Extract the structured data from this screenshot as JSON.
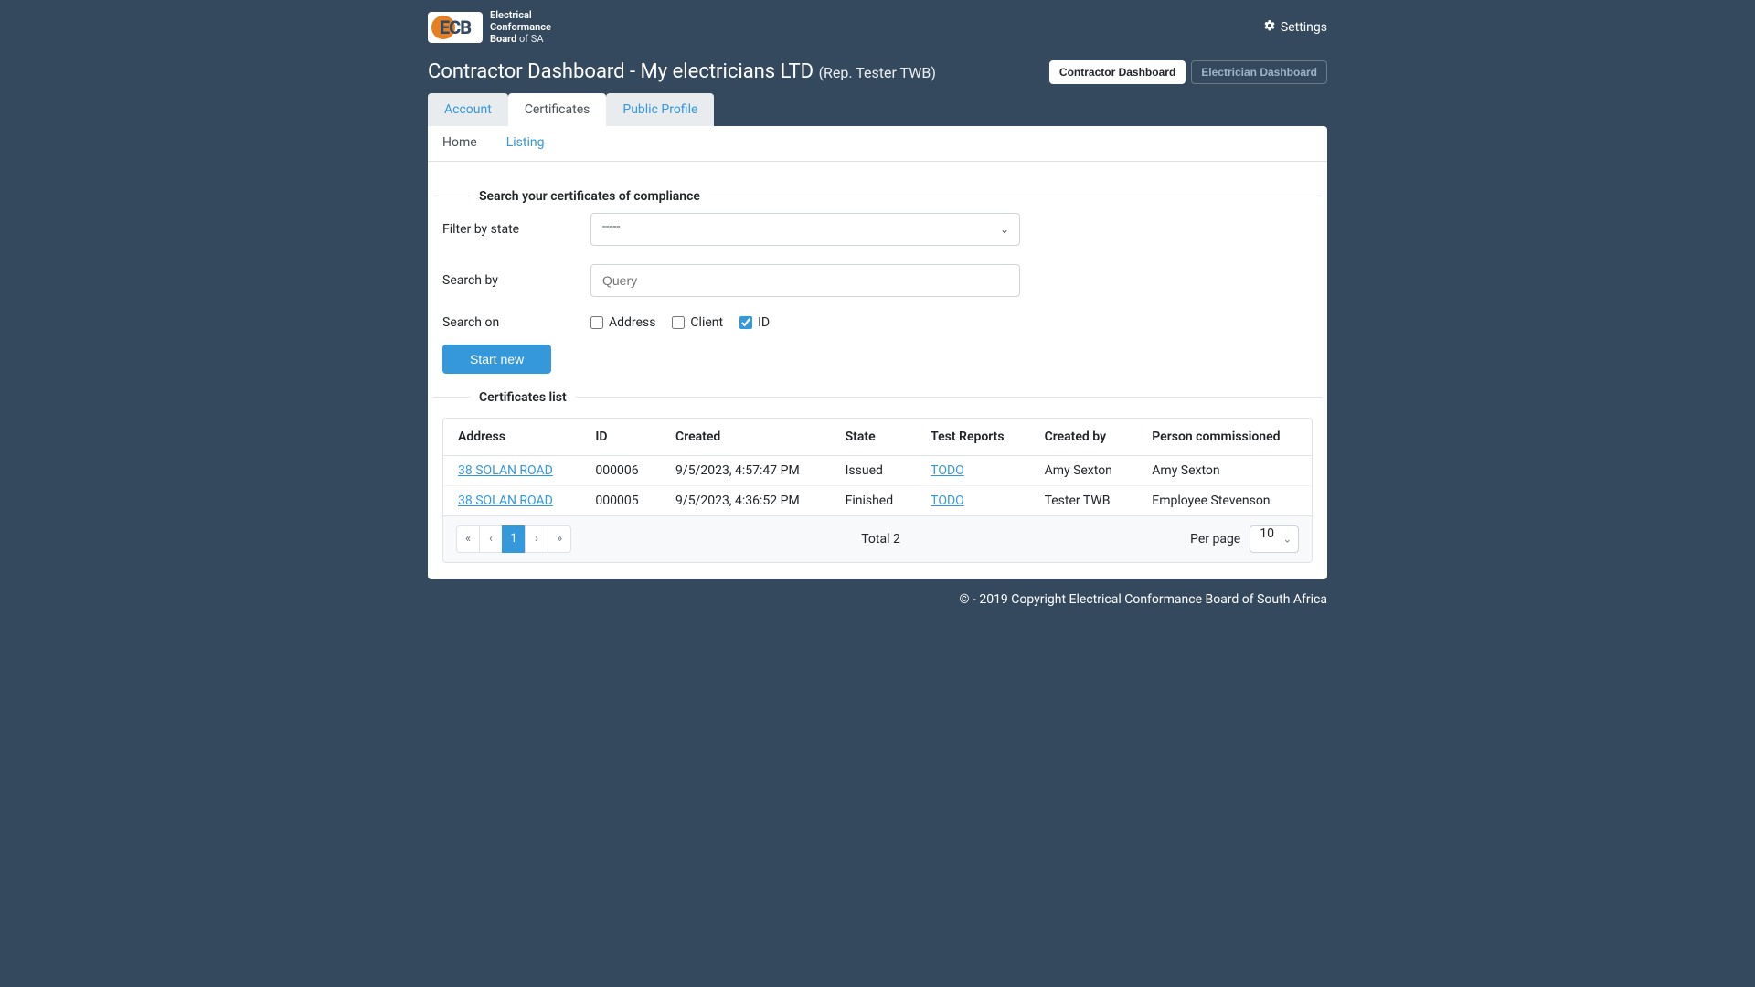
{
  "header": {
    "logo_abbrev": "ECB",
    "logo_line1": "Electrical",
    "logo_line2": "Conformance",
    "logo_line3": "Board",
    "logo_suffix": "of SA",
    "settings_label": "Settings"
  },
  "title": {
    "main": "Contractor Dashboard - My electricians LTD",
    "sub": "(Rep. Tester TWB)"
  },
  "dash_toggle": {
    "contractor": "Contractor Dashboard",
    "electrician": "Electrician Dashboard"
  },
  "main_tabs": {
    "account": "Account",
    "certificates": "Certificates",
    "public_profile": "Public Profile"
  },
  "sub_tabs": {
    "home": "Home",
    "listing": "Listing"
  },
  "search_section": {
    "legend": "Search your certificates of compliance",
    "filter_label": "Filter by state",
    "filter_value": "-----",
    "search_by_label": "Search by",
    "search_by_placeholder": "Query",
    "search_on_label": "Search on",
    "chk_address": "Address",
    "chk_client": "Client",
    "chk_id": "ID",
    "chk_address_checked": false,
    "chk_client_checked": false,
    "chk_id_checked": true,
    "start_new": "Start new"
  },
  "list_section": {
    "legend": "Certificates list",
    "columns": {
      "address": "Address",
      "id": "ID",
      "created": "Created",
      "state": "State",
      "test_reports": "Test Reports",
      "created_by": "Created by",
      "person_commissioned": "Person commissioned"
    },
    "rows": [
      {
        "address": "38 SOLAN ROAD",
        "id": "000006",
        "created": "9/5/2023, 4:57:47 PM",
        "state": "Issued",
        "test_reports": "TODO",
        "created_by": "Amy Sexton",
        "person_commissioned": "Amy Sexton"
      },
      {
        "address": "38 SOLAN ROAD",
        "id": "000005",
        "created": "9/5/2023, 4:36:52 PM",
        "state": "Finished",
        "test_reports": "TODO",
        "created_by": "Tester TWB",
        "person_commissioned": "Employee Stevenson"
      }
    ],
    "pager": {
      "first": "«",
      "prev": "‹",
      "page1": "1",
      "next": "›",
      "last": "»"
    },
    "total_label": "Total 2",
    "per_page_label": "Per page",
    "per_page_value": "10"
  },
  "footer": {
    "copyright": "© - 2019 Copyright Electrical Conformance Board of South Africa"
  }
}
